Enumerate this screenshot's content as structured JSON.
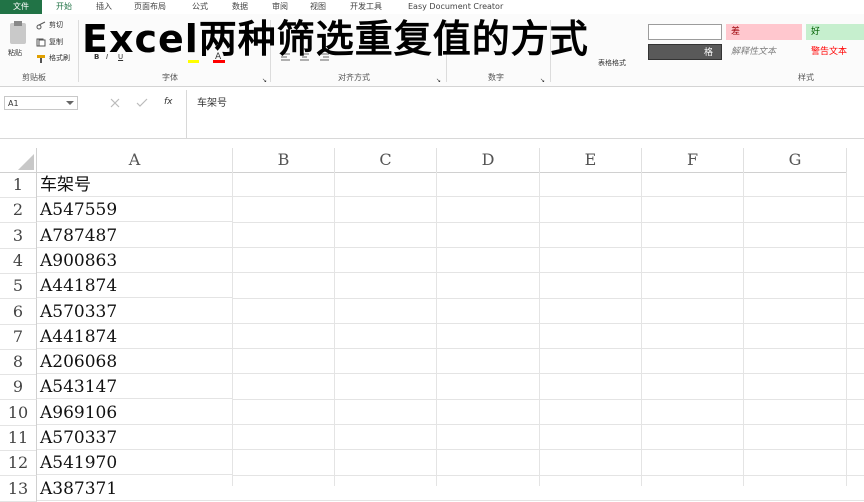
{
  "tabs": [
    "文件",
    "开始",
    "插入",
    "页面布局",
    "公式",
    "数据",
    "审阅",
    "视图",
    "开发工具",
    "Easy Document Creator"
  ],
  "ribbon": {
    "clipboard": {
      "paste": "粘贴",
      "cut": "剪切",
      "copy": "复制",
      "format_painter": "格式刷",
      "label": "剪贴板"
    },
    "font_label": "字体",
    "align_label": "对齐方式",
    "number_label": "数字",
    "table_format": "表格格式",
    "styles_label": "样式",
    "style_cells": {
      "bad": "差",
      "good": "好",
      "explanatory": "解释性文本",
      "warning": "警告文本",
      "check": "格"
    }
  },
  "overlay_title": "Excel两种筛选重复值的方式",
  "formula_bar": {
    "name_box": "A1",
    "formula": "车架号"
  },
  "columns": [
    "A",
    "B",
    "C",
    "D",
    "E",
    "F",
    "G"
  ],
  "rows": [
    {
      "n": "1",
      "a": "车架号"
    },
    {
      "n": "2",
      "a": "A547559"
    },
    {
      "n": "3",
      "a": "A787487"
    },
    {
      "n": "4",
      "a": "A900863"
    },
    {
      "n": "5",
      "a": "A441874"
    },
    {
      "n": "6",
      "a": "A570337"
    },
    {
      "n": "7",
      "a": "A441874"
    },
    {
      "n": "8",
      "a": "A206068"
    },
    {
      "n": "9",
      "a": "A543147"
    },
    {
      "n": "10",
      "a": "A969106"
    },
    {
      "n": "11",
      "a": "A570337"
    },
    {
      "n": "12",
      "a": "A541970"
    },
    {
      "n": "13",
      "a": "A387371"
    }
  ],
  "colors": {
    "file_tab": "#217346",
    "bad_bg": "#ffc7ce",
    "bad_fg": "#9c0006",
    "good_bg": "#c6efce",
    "good_fg": "#006100",
    "warning_fg": "#ff0000"
  }
}
